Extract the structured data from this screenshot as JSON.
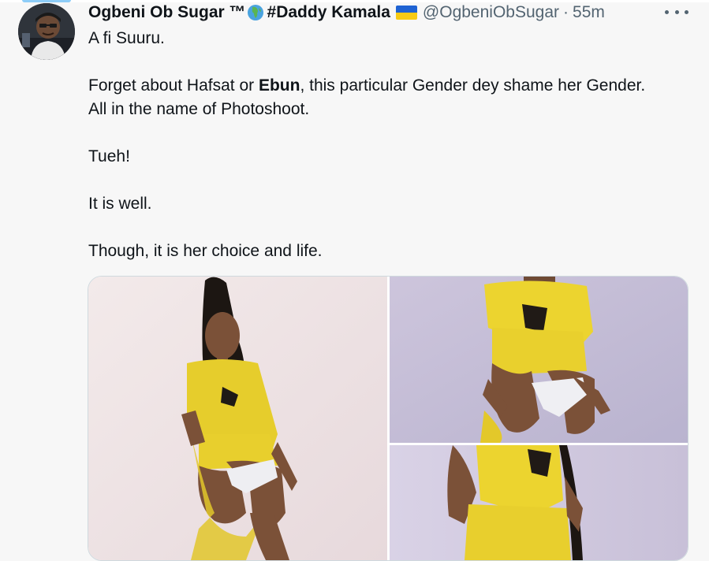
{
  "tweet": {
    "display_name": "Ogbeni Ob Sugar ™",
    "name_emoji": "globe-africa-icon",
    "hashtag": "#Daddy Kamala",
    "flag_emoji": "ukraine-flag-icon",
    "handle": "@OgbeniObSugar",
    "separator": "·",
    "time": "55m",
    "lines": {
      "line1": "A fi Suuru.",
      "line2_prefix": "Forget about Hafsat or ",
      "line2_bold": "Ebun",
      "line2_suffix": ", this particular Gender dey shame her Gender.",
      "line3": "All in the name of Photoshoot.",
      "line4": "Tueh!",
      "line5": "It is well.",
      "line6": "Though, it is her choice and life."
    },
    "media": {
      "count": 3,
      "images": [
        {
          "name": "photo-woman-yellow-outfit-seated"
        },
        {
          "name": "photo-woman-yellow-outfit-closeup"
        },
        {
          "name": "photo-woman-yellow-outfit-standing"
        }
      ]
    }
  },
  "colors": {
    "text": "#0f1419",
    "secondary": "#536471",
    "border": "#cfd9de",
    "accent": "#8ecdf8",
    "background": "#f7f7f7"
  }
}
